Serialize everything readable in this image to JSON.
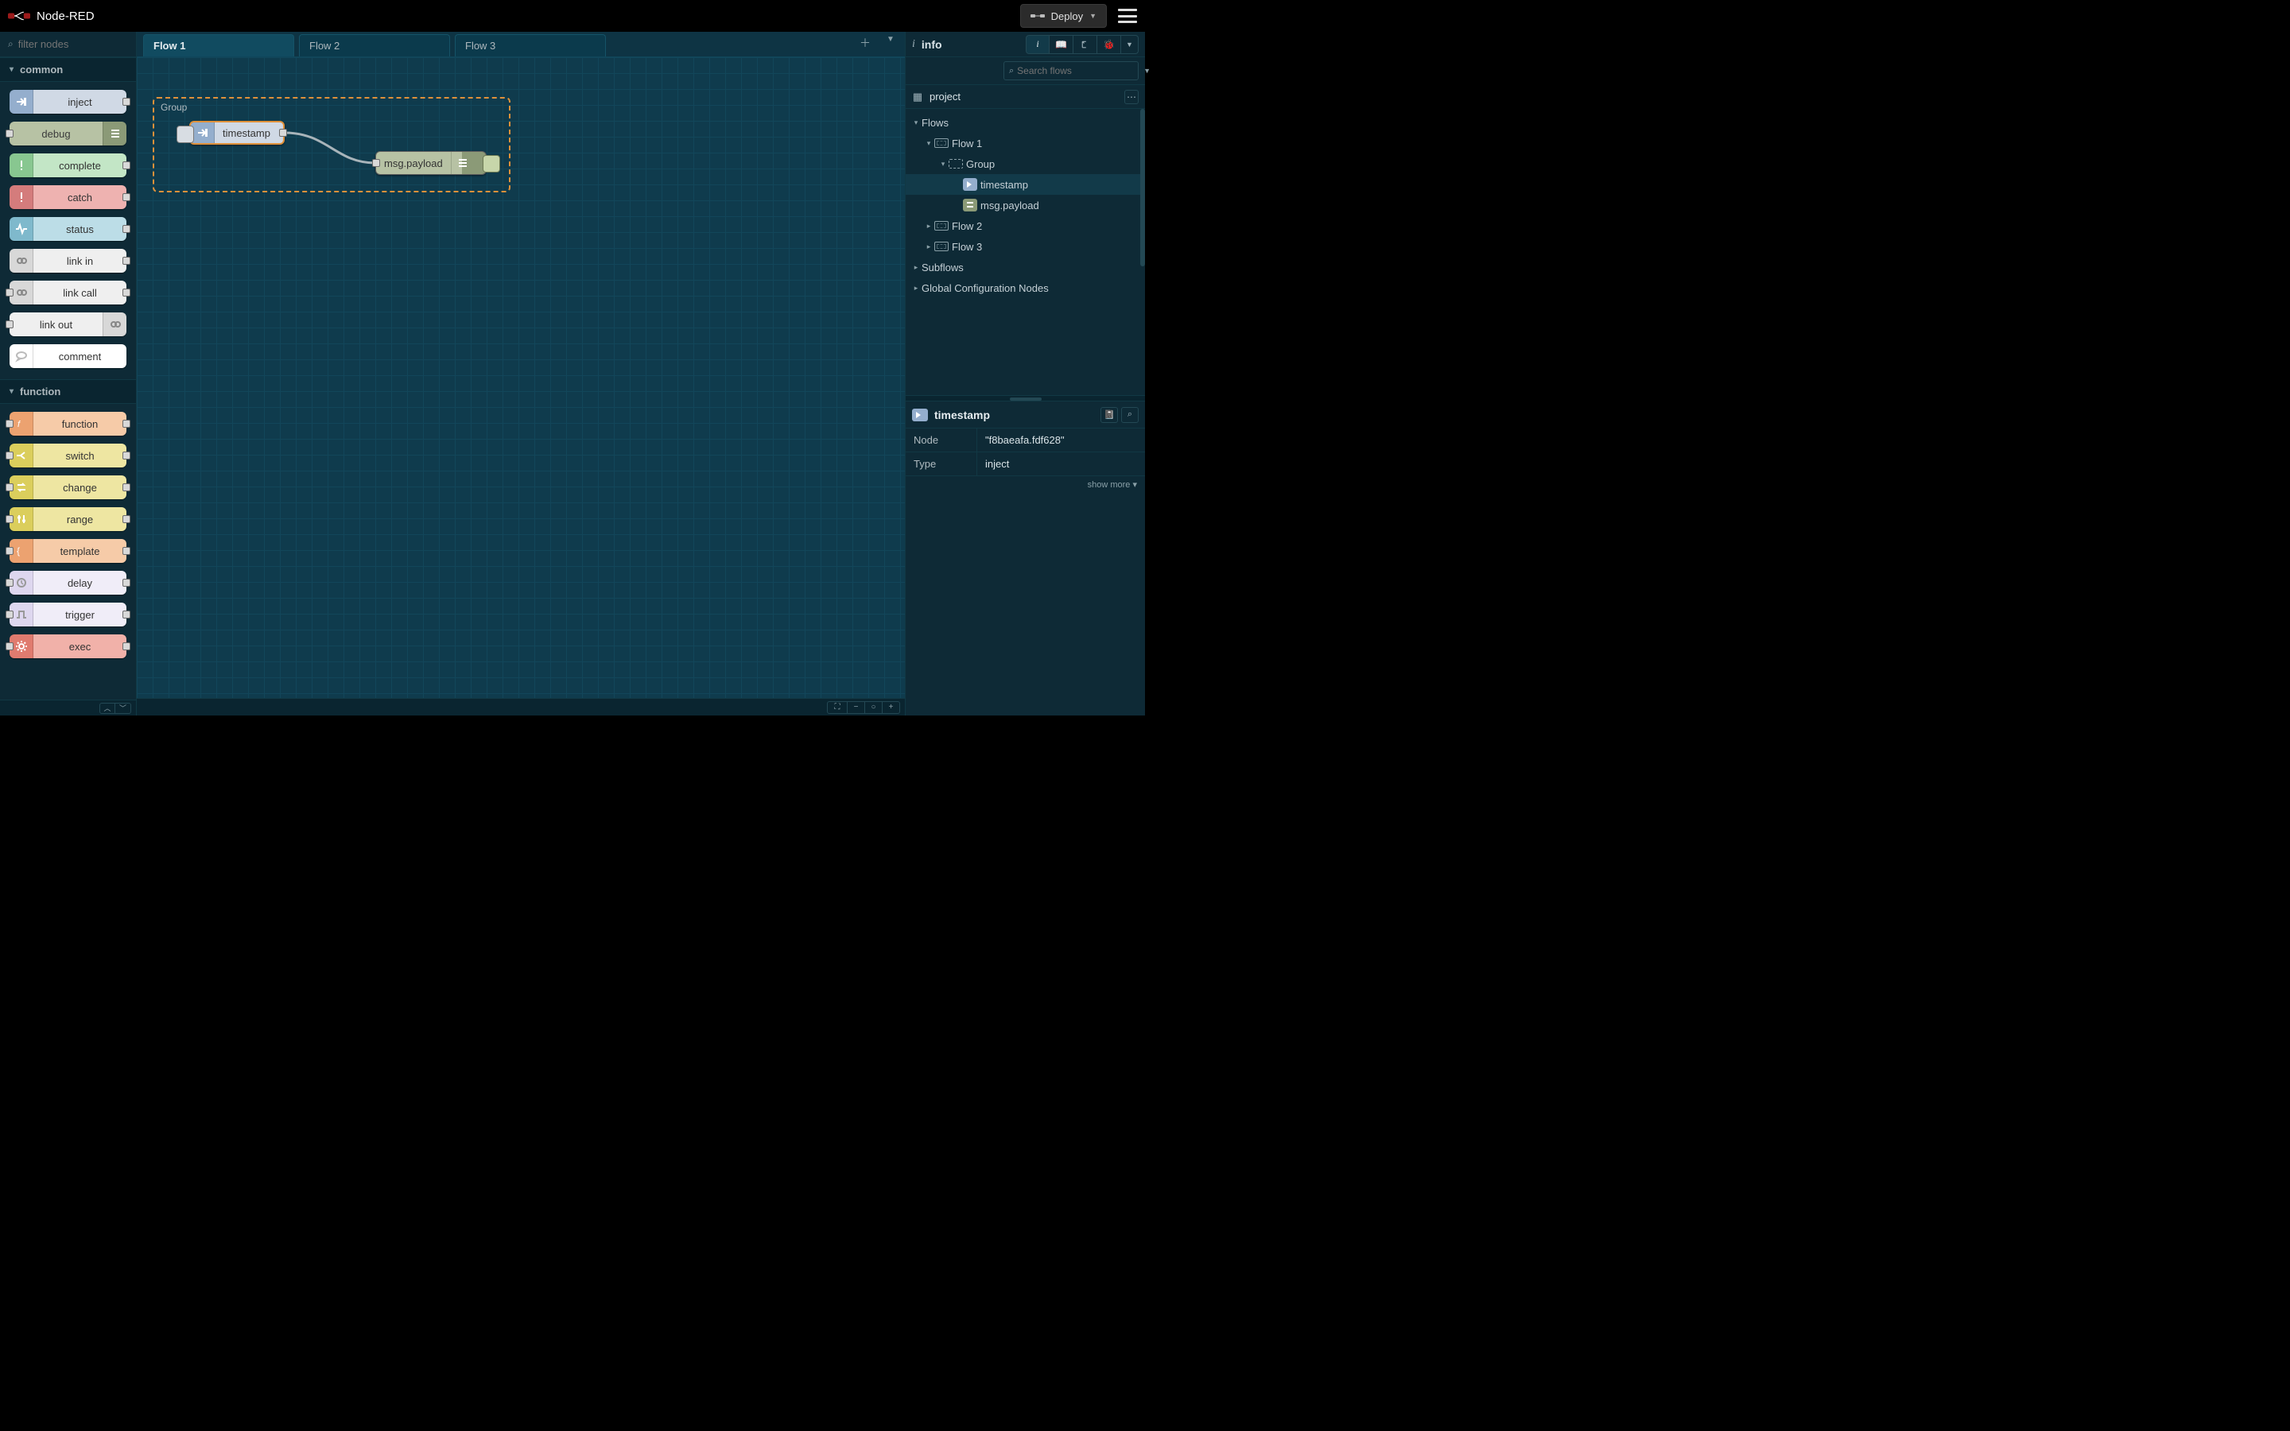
{
  "header": {
    "app_name": "Node-RED",
    "deploy_label": "Deploy"
  },
  "palette": {
    "filter_placeholder": "filter nodes",
    "categories": [
      {
        "name": "common",
        "nodes": [
          {
            "label": "inject",
            "cls": "c-inject",
            "port_r": true,
            "icon": "arrow-in"
          },
          {
            "label": "debug",
            "cls": "c-debug",
            "port_l": true,
            "icon_right": true,
            "icon": "bars"
          },
          {
            "label": "complete",
            "cls": "c-complete",
            "port_r": true,
            "icon": "bang"
          },
          {
            "label": "catch",
            "cls": "c-catch",
            "port_r": true,
            "icon": "bang"
          },
          {
            "label": "status",
            "cls": "c-status",
            "port_r": true,
            "icon": "pulse"
          },
          {
            "label": "link in",
            "cls": "c-link",
            "port_r": true,
            "icon": "link"
          },
          {
            "label": "link call",
            "cls": "c-link",
            "port_l": true,
            "port_r": true,
            "icon": "link"
          },
          {
            "label": "link out",
            "cls": "c-link-out",
            "port_l": true,
            "icon_right": true,
            "icon": "link"
          },
          {
            "label": "comment",
            "cls": "c-comment",
            "icon": "bubble"
          }
        ]
      },
      {
        "name": "function",
        "nodes": [
          {
            "label": "function",
            "cls": "c-function",
            "port_l": true,
            "port_r": true,
            "icon": "fn"
          },
          {
            "label": "switch",
            "cls": "c-switch",
            "port_l": true,
            "port_r": true,
            "icon": "branch"
          },
          {
            "label": "change",
            "cls": "c-change",
            "port_l": true,
            "port_r": true,
            "icon": "swap"
          },
          {
            "label": "range",
            "cls": "c-range",
            "port_l": true,
            "port_r": true,
            "icon": "slider"
          },
          {
            "label": "template",
            "cls": "c-template",
            "port_l": true,
            "port_r": true,
            "icon": "braces"
          },
          {
            "label": "delay",
            "cls": "c-delay",
            "port_l": true,
            "port_r": true,
            "icon": "clock"
          },
          {
            "label": "trigger",
            "cls": "c-trigger",
            "port_l": true,
            "port_r": true,
            "icon": "square-pulse"
          },
          {
            "label": "exec",
            "cls": "c-exec",
            "port_l": true,
            "port_r": true,
            "icon": "gear"
          }
        ]
      }
    ]
  },
  "workspace": {
    "tabs": [
      "Flow 1",
      "Flow 2",
      "Flow 3"
    ],
    "active_tab": 0,
    "group_label": "Group",
    "nodes": {
      "inject_label": "timestamp",
      "debug_label": "msg.payload"
    }
  },
  "sidebar": {
    "title": "info",
    "search_placeholder": "Search flows",
    "project_label": "project",
    "tree": {
      "flows": "Flows",
      "flow1": "Flow 1",
      "group": "Group",
      "node_inject": "timestamp",
      "node_debug": "msg.payload",
      "flow2": "Flow 2",
      "flow3": "Flow 3",
      "subflows": "Subflows",
      "global": "Global Configuration Nodes"
    },
    "selected_node": {
      "name": "timestamp",
      "props": {
        "node_key": "Node",
        "node_val": "\"f8baeafa.fdf628\"",
        "type_key": "Type",
        "type_val": "inject"
      }
    },
    "show_more": "show more ▾"
  }
}
